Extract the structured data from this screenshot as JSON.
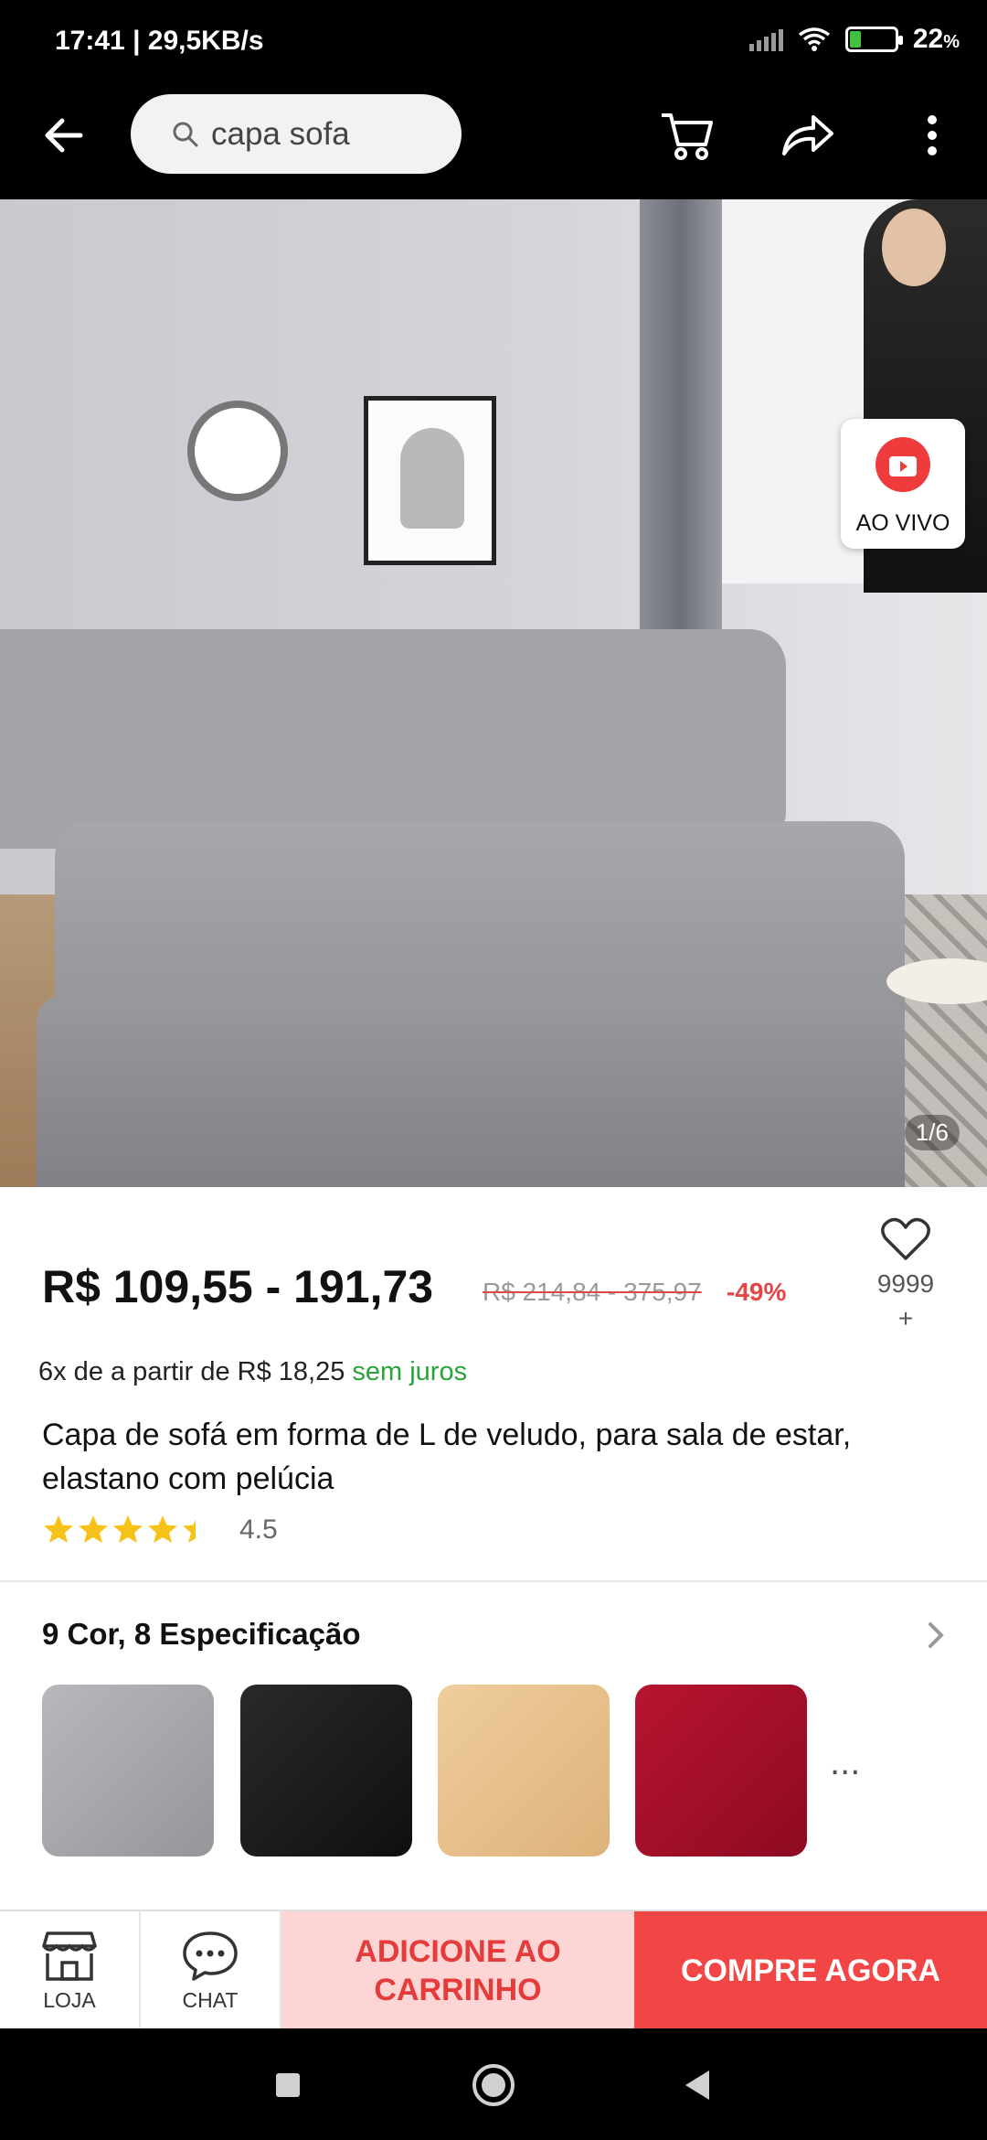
{
  "status_bar": {
    "time": "17:41 | 29,5KB/s",
    "battery": "22",
    "battery_unit": "%"
  },
  "header": {
    "search_text": "capa sofa",
    "icons": [
      "back-arrow-icon",
      "search-icon",
      "cart-icon",
      "share-icon",
      "more-vertical-icon"
    ]
  },
  "gallery": {
    "counter": "1/6",
    "live_label": "AO VIVO"
  },
  "product": {
    "price": "R$ 109,55 - 191,73",
    "original_price": "R$ 214,84 - 375,97",
    "discount": "-49%",
    "favorites": "9999",
    "favorites_suffix": "+",
    "installment": "6x de a partir de R$ 18,25",
    "installment_note": "sem juros",
    "title": "Capa de sofá em forma de L de veludo, para sala de estar, elastano com pelúcia",
    "rating": "4.5",
    "rating_fraction": 0.9
  },
  "variants": {
    "heading": "9 Cor, 8 Especificação",
    "more": "...",
    "swatch_colors": [
      "#a9a9ad",
      "#1e1e1e",
      "#e8c08c",
      "#a5102a"
    ]
  },
  "actions": {
    "store_label": "LOJA",
    "chat_label": "CHAT",
    "add_to_cart": "ADICIONE AO CARRINHO",
    "buy_now": "COMPRE AGORA"
  },
  "colors": {
    "accent": "#f24646",
    "accent_light": "#fdd5d5",
    "discount": "#e64545",
    "green": "#2aa33a",
    "star": "#f6c218"
  }
}
